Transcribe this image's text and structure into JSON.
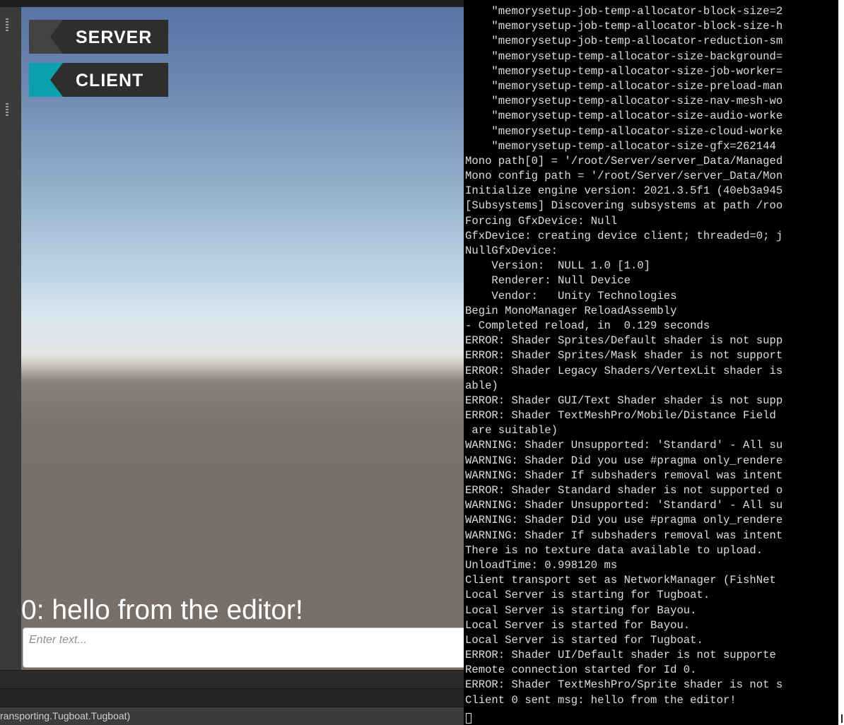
{
  "game_view": {
    "server_button": {
      "label": "SERVER"
    },
    "client_button": {
      "label": "CLIENT"
    },
    "chat_message": "0: hello from the editor!",
    "chat_input": {
      "placeholder": "Enter text...",
      "value": ""
    }
  },
  "status_bar": {
    "text": "ransporting.Tugboat.Tugboat)"
  },
  "console": {
    "lines": [
      "    \"memorysetup-job-temp-allocator-block-size=2",
      "    \"memorysetup-job-temp-allocator-block-size-h",
      "    \"memorysetup-job-temp-allocator-reduction-sm",
      "    \"memorysetup-temp-allocator-size-background=",
      "    \"memorysetup-temp-allocator-size-job-worker=",
      "    \"memorysetup-temp-allocator-size-preload-man",
      "    \"memorysetup-temp-allocator-size-nav-mesh-wo",
      "    \"memorysetup-temp-allocator-size-audio-worke",
      "    \"memorysetup-temp-allocator-size-cloud-worke",
      "    \"memorysetup-temp-allocator-size-gfx=262144",
      "Mono path[0] = '/root/Server/server_Data/Managed",
      "Mono config path = '/root/Server/server_Data/Mon",
      "Initialize engine version: 2021.3.5f1 (40eb3a945",
      "[Subsystems] Discovering subsystems at path /roo",
      "Forcing GfxDevice: Null",
      "GfxDevice: creating device client; threaded=0; j",
      "NullGfxDevice:",
      "    Version:  NULL 1.0 [1.0]",
      "    Renderer: Null Device",
      "    Vendor:   Unity Technologies",
      "Begin MonoManager ReloadAssembly",
      "- Completed reload, in  0.129 seconds",
      "ERROR: Shader Sprites/Default shader is not supp",
      "ERROR: Shader Sprites/Mask shader is not support",
      "ERROR: Shader Legacy Shaders/VertexLit shader is",
      "able)",
      "ERROR: Shader GUI/Text Shader shader is not supp",
      "ERROR: Shader TextMeshPro/Mobile/Distance Field",
      " are suitable)",
      "WARNING: Shader Unsupported: 'Standard' - All su",
      "WARNING: Shader Did you use #pragma only_rendere",
      "WARNING: Shader If subshaders removal was intent",
      "ERROR: Shader Standard shader is not supported o",
      "WARNING: Shader Unsupported: 'Standard' - All su",
      "WARNING: Shader Did you use #pragma only_rendere",
      "WARNING: Shader If subshaders removal was intent",
      "There is no texture data available to upload.",
      "UnloadTime: 0.998120 ms",
      "Client transport set as NetworkManager (FishNet",
      "Local Server is starting for Tugboat.",
      "Local Server is starting for Bayou.",
      "Local Server is started for Bayou.",
      "Local Server is started for Tugboat.",
      "ERROR: Shader UI/Default shader is not supporte",
      "Remote connection started for Id 0.",
      "ERROR: Shader TextMeshPro/Sprite shader is not s",
      "Client 0 sent msg: hello from the editor!"
    ]
  }
}
